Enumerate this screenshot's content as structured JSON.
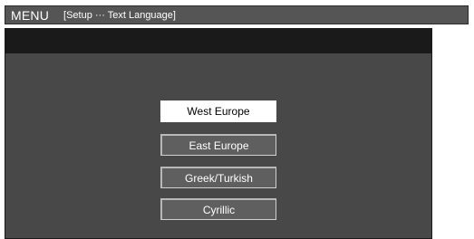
{
  "menu": {
    "title": "MENU",
    "path": "[Setup ··· Text Language]"
  },
  "options": [
    {
      "label": "West Europe",
      "selected": true
    },
    {
      "label": "East Europe",
      "selected": false
    },
    {
      "label": "Greek/Turkish",
      "selected": false
    },
    {
      "label": "Cyrillic",
      "selected": false
    }
  ],
  "colors": {
    "menu_bar": "#555555",
    "panel": "#484848",
    "panel_header": "#1a1a1a",
    "selected_bg": "#ffffff",
    "option_bg": "#5f5f5f"
  }
}
